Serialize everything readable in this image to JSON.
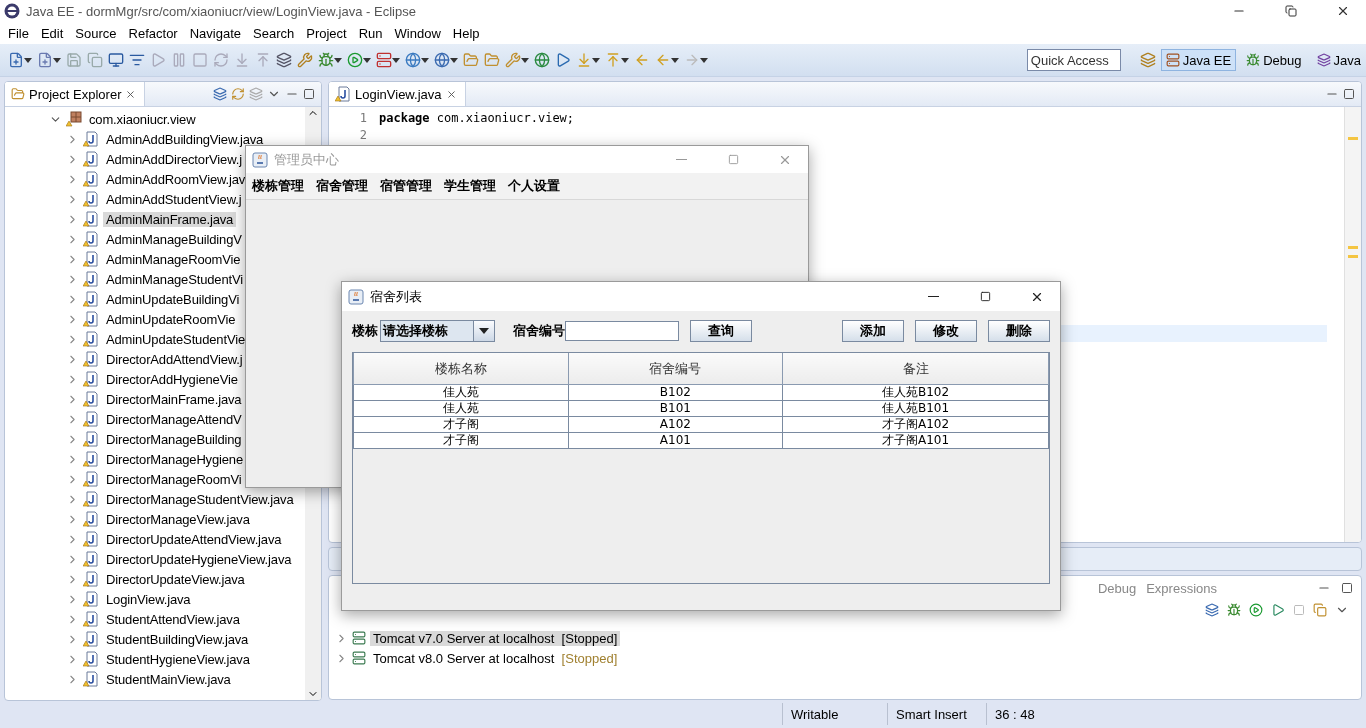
{
  "window": {
    "title": "Java EE - dormMgr/src/com/xiaoniucr/view/LoginView.java - Eclipse"
  },
  "menu": [
    "File",
    "Edit",
    "Source",
    "Refactor",
    "Navigate",
    "Search",
    "Project",
    "Run",
    "Window",
    "Help"
  ],
  "quick_access": {
    "placeholder": "Quick Access"
  },
  "perspectives": [
    {
      "label": "Java EE",
      "selected": true
    },
    {
      "label": "Debug",
      "selected": false
    },
    {
      "label": "Java",
      "selected": false
    }
  ],
  "project_explorer": {
    "title": "Project Explorer",
    "tree": [
      {
        "label": "com.xiaoniucr.view",
        "expanded": true,
        "selected": false,
        "children": [
          {
            "label": "AdminAddBuildingView.java",
            "expanded": false,
            "selected": false
          },
          {
            "label": "AdminAddDirectorView.j",
            "expanded": false,
            "selected": false
          },
          {
            "label": "AdminAddRoomView.jav",
            "expanded": false,
            "selected": false
          },
          {
            "label": "AdminAddStudentView.j",
            "expanded": false,
            "selected": false
          },
          {
            "label": "AdminMainFrame.java",
            "expanded": false,
            "selected": true
          },
          {
            "label": "AdminManageBuildingV",
            "expanded": false,
            "selected": false
          },
          {
            "label": "AdminManageRoomVie",
            "expanded": false,
            "selected": false
          },
          {
            "label": "AdminManageStudentVi",
            "expanded": false,
            "selected": false
          },
          {
            "label": "AdminUpdateBuildingVi",
            "expanded": false,
            "selected": false
          },
          {
            "label": "AdminUpdateRoomVie",
            "expanded": false,
            "selected": false
          },
          {
            "label": "AdminUpdateStudentVie",
            "expanded": false,
            "selected": false
          },
          {
            "label": "DirectorAddAttendView.j",
            "expanded": false,
            "selected": false
          },
          {
            "label": "DirectorAddHygieneVie",
            "expanded": false,
            "selected": false
          },
          {
            "label": "DirectorMainFrame.java",
            "expanded": false,
            "selected": false
          },
          {
            "label": "DirectorManageAttendV",
            "expanded": false,
            "selected": false
          },
          {
            "label": "DirectorManageBuilding",
            "expanded": false,
            "selected": false
          },
          {
            "label": "DirectorManageHygiene",
            "expanded": false,
            "selected": false
          },
          {
            "label": "DirectorManageRoomVi",
            "expanded": false,
            "selected": false
          },
          {
            "label": "DirectorManageStudentView.java",
            "expanded": false,
            "selected": false
          },
          {
            "label": "DirectorManageView.java",
            "expanded": false,
            "selected": false
          },
          {
            "label": "DirectorUpdateAttendView.java",
            "expanded": false,
            "selected": false
          },
          {
            "label": "DirectorUpdateHygieneView.java",
            "expanded": false,
            "selected": false
          },
          {
            "label": "DirectorUpdateView.java",
            "expanded": false,
            "selected": false
          },
          {
            "label": "LoginView.java",
            "expanded": false,
            "selected": false
          },
          {
            "label": "StudentAttendView.java",
            "expanded": false,
            "selected": false
          },
          {
            "label": "StudentBuildingView.java",
            "expanded": false,
            "selected": false
          },
          {
            "label": "StudentHygieneView.java",
            "expanded": false,
            "selected": false
          },
          {
            "label": "StudentMainView.java",
            "expanded": false,
            "selected": false
          }
        ]
      }
    ]
  },
  "editor": {
    "tab": "LoginView.java",
    "lines": [
      {
        "number": "1",
        "code": "**package** com.xiaoniucr.view;"
      },
      {
        "number": "2"
      }
    ]
  },
  "bottom_panel": {
    "tabs": [
      "Debug",
      "Expressions"
    ],
    "servers": [
      {
        "name": "Tomcat v7.0 Server at localhost",
        "status": "[Stopped]",
        "selected": true
      },
      {
        "name": "Tomcat v8.0 Server at localhost",
        "status": "[Stopped]",
        "selected": false
      }
    ]
  },
  "status_bar": [
    "Writable",
    "Smart Insert",
    "36 : 48"
  ],
  "admin_window": {
    "title": "管理员中心",
    "menu": [
      "楼栋管理",
      "宿舍管理",
      "宿管管理",
      "学生管理",
      "个人设置"
    ]
  },
  "dorm_window": {
    "title": "宿舍列表",
    "building_label": "楼栋",
    "building_value": "请选择楼栋",
    "room_label": "宿舍编号",
    "search_button": "查询",
    "actions": [
      "添加",
      "修改",
      "删除"
    ],
    "table": {
      "columns": [
        "楼栋名称",
        "宿舍编号",
        "备注"
      ],
      "rows": [
        [
          "佳人苑",
          "B102",
          "佳人苑B102"
        ],
        [
          "佳人苑",
          "B101",
          "佳人苑B101"
        ],
        [
          "才子阁",
          "A102",
          "才子阁A102"
        ],
        [
          "才子阁",
          "A101",
          "才子阁A101"
        ]
      ]
    }
  }
}
